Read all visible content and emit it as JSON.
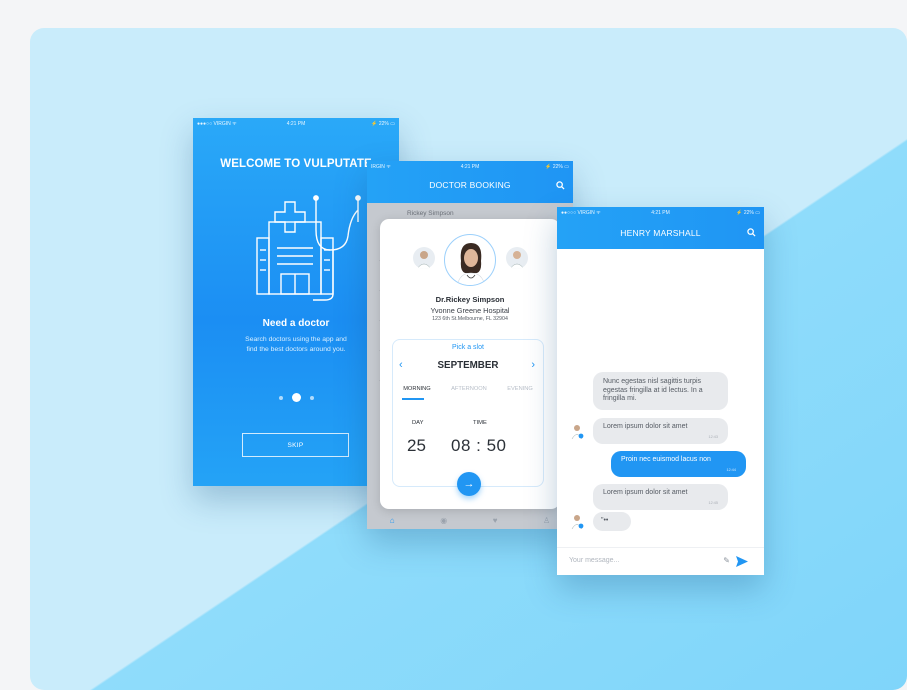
{
  "colors": {
    "accent": "#2196f3",
    "bg_light": "#c9ecfb",
    "bg_deep": "#7fd5fa"
  },
  "status_bar": {
    "carrier": "VIRGIN",
    "time": "4:21 PM",
    "battery": "22%",
    "carrier_short": "IRGIN",
    "carrier_p3": "VIRGIN"
  },
  "welcome": {
    "title": "WELCOME TO VULPUTATE",
    "heading": "Need a doctor",
    "description": "Search doctors using the app and find the best doctors around you.",
    "skip_label": "SKIP",
    "page_index": 2,
    "page_count": 3
  },
  "booking": {
    "title": "DOCTOR BOOKING",
    "background_name": "Rickey Simpson",
    "doctor_name": "Dr.Rickey Simpson",
    "hospital": "Yvonne Greene Hospital",
    "address": "123 6th St.Melbourne, FL 32904",
    "pick_label": "Pick a slot",
    "month": "SEPTEMBER",
    "periods": [
      "MORNING",
      "AFTERNOON",
      "EVENING"
    ],
    "day_label": "DAY",
    "time_label": "TIME",
    "day_value": "25",
    "time_value": "08 : 50"
  },
  "chat": {
    "title": "HENRY MARSHALL",
    "messages": [
      {
        "from": "in",
        "text": "Nunc egestas nisl sagittis turpis egestas fringilla at id lectus. In a fringilla mi."
      },
      {
        "from": "in",
        "text": "Lorem ipsum dolor sit amet",
        "time": "12:43"
      },
      {
        "from": "out",
        "text": "Proin nec euismod lacus non",
        "time": "12:44"
      },
      {
        "from": "in",
        "text": "Lorem ipsum dolor sit amet",
        "time": "12:45"
      },
      {
        "from": "in",
        "text": "\"••"
      }
    ],
    "input_placeholder": "Your message..."
  }
}
